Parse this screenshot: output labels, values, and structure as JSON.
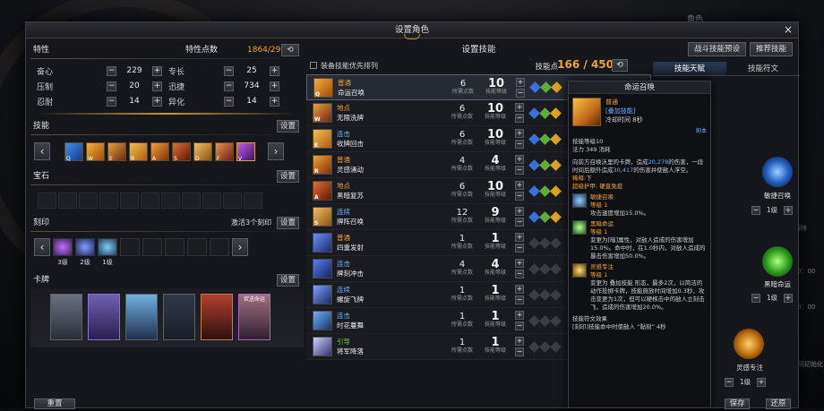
{
  "colors": {
    "accent": "#f2a23a",
    "green": "#7ac64e",
    "blue": "#6ab0ff"
  },
  "side": {
    "title": "角色",
    "labels": [
      "解除",
      "0：00",
      "0：00",
      "时间初始化",
      "保存",
      "还原"
    ]
  },
  "window": {
    "title": "设置角色",
    "close": "×"
  },
  "traits": {
    "header": "特性",
    "points_label": "特性点数",
    "points": "1864/2900",
    "items": [
      {
        "name": "奋心",
        "value": "229"
      },
      {
        "name": "专长",
        "value": "25"
      },
      {
        "name": "压制",
        "value": "20"
      },
      {
        "name": "迅捷",
        "value": "734"
      },
      {
        "name": "忍耐",
        "value": "14"
      },
      {
        "name": "异化",
        "value": "14"
      }
    ]
  },
  "skills_section": {
    "header": "技能",
    "settings": "设置",
    "keys": [
      "Q",
      "W",
      "E",
      "R",
      "A",
      "S",
      "D",
      "F",
      "V"
    ]
  },
  "gems": {
    "header": "宝石",
    "settings": "设置"
  },
  "runes": {
    "header": "刻印",
    "activated": "激活3个刻印",
    "settings": "设置",
    "levels": [
      "3级",
      "2级",
      "1级",
      "",
      "",
      "",
      "",
      ""
    ]
  },
  "cards": {
    "header": "卡牌",
    "settings": "设置",
    "names": [
      "",
      "",
      "",
      "",
      "",
      "欢送命运"
    ]
  },
  "reset_button": "重置",
  "skill_setup": {
    "title": "设置技能",
    "priority_label": "装备技能优先排列",
    "points_label": "技能点",
    "points": "166 / 450",
    "cost_label": "所需点数",
    "level_label": "技能等级",
    "rows": [
      {
        "key": "Q",
        "type": "普通",
        "name": "命运召唤",
        "cost": "6",
        "level": "10",
        "color": "#f2a23a"
      },
      {
        "key": "W",
        "type": "地点",
        "name": "无限洗牌",
        "cost": "6",
        "level": "10",
        "color": "#f2a23a"
      },
      {
        "key": "E",
        "type": "连击",
        "name": "收牌回击",
        "cost": "6",
        "level": "10",
        "color": "#6ab0ff"
      },
      {
        "key": "R",
        "type": "普通",
        "name": "灵感涌动",
        "cost": "4",
        "level": "4",
        "color": "#f2a23a"
      },
      {
        "key": "A",
        "type": "地点",
        "name": "黑暗复苏",
        "cost": "6",
        "level": "10",
        "color": "#f2a23a"
      },
      {
        "key": "S",
        "type": "连续",
        "name": "牌阵召唤",
        "cost": "12",
        "level": "9",
        "color": "#6ab0ff"
      },
      {
        "key": "",
        "type": "普通",
        "name": "四重发射",
        "cost": "1",
        "level": "1",
        "color": "#f2a23a"
      },
      {
        "key": "",
        "type": "连击",
        "name": "牌刻冲击",
        "cost": "4",
        "level": "4",
        "color": "#6ab0ff"
      },
      {
        "key": "",
        "type": "连续",
        "name": "螺旋飞牌",
        "cost": "1",
        "level": "1",
        "color": "#6ab0ff"
      },
      {
        "key": "",
        "type": "连击",
        "name": "时花蔓舞",
        "cost": "1",
        "level": "1",
        "color": "#6ab0ff"
      },
      {
        "key": "",
        "type": "引导",
        "name": "将军降落",
        "cost": "1",
        "level": "1",
        "color": "#7ac64e"
      }
    ]
  },
  "right": {
    "preset": "战斗技能预设",
    "recommend": "推荐技能",
    "tab_active": "技能天赋",
    "tab_other": "技能符文",
    "orbs": [
      {
        "name": "敏捷召唤",
        "level": "1级"
      },
      {
        "name": "黑暗命运",
        "level": "1级"
      },
      {
        "name": "灵感专注",
        "level": "1级"
      }
    ],
    "save": "保存",
    "revert": "还原"
  },
  "tooltip": {
    "title": "命运召唤",
    "type": "普通",
    "tag": "[叠加技能]",
    "cooldown": "冷却时间 8秒",
    "extra": "剧本",
    "level": "技能等级10",
    "mana": "法力 349 消耗",
    "desc1": "向前方召唤沃里的卡牌，造成",
    "dmg1": "20,278",
    "desc2": "的伤害，一段时间后额外造成",
    "dmg2": "30,417",
    "desc3": "的伤害并使敌人浮空。",
    "hit": "稀释:下",
    "super": "超级护甲: 硬直免疫",
    "feats": [
      {
        "name": "敏捷召唤",
        "lv": "等级 1",
        "text": "攻击速度增加15.0%。"
      },
      {
        "name": "黑暗命运",
        "lv": "等级 1",
        "text": "变更为[暗]属性，对敌人造成的伤害增加15.0%。命中时，在1.0秒内，对敌人造成的暴击伤害增加50.0%。"
      },
      {
        "name": "灵感专注",
        "lv": "等级 1",
        "text": "变更为 叠加技能 形态，最多2次，以简洁的动作投掷卡牌，技能施放时间增加0.3秒，攻击变更为1次，但可以硬核击中的敌人立刻击飞，造成的伤害增加20.0%。"
      }
    ],
    "rune_title": "技能符文效果",
    "rune_text": "[刻印]技能命中时使敌人 “黏刻” 4秒"
  }
}
